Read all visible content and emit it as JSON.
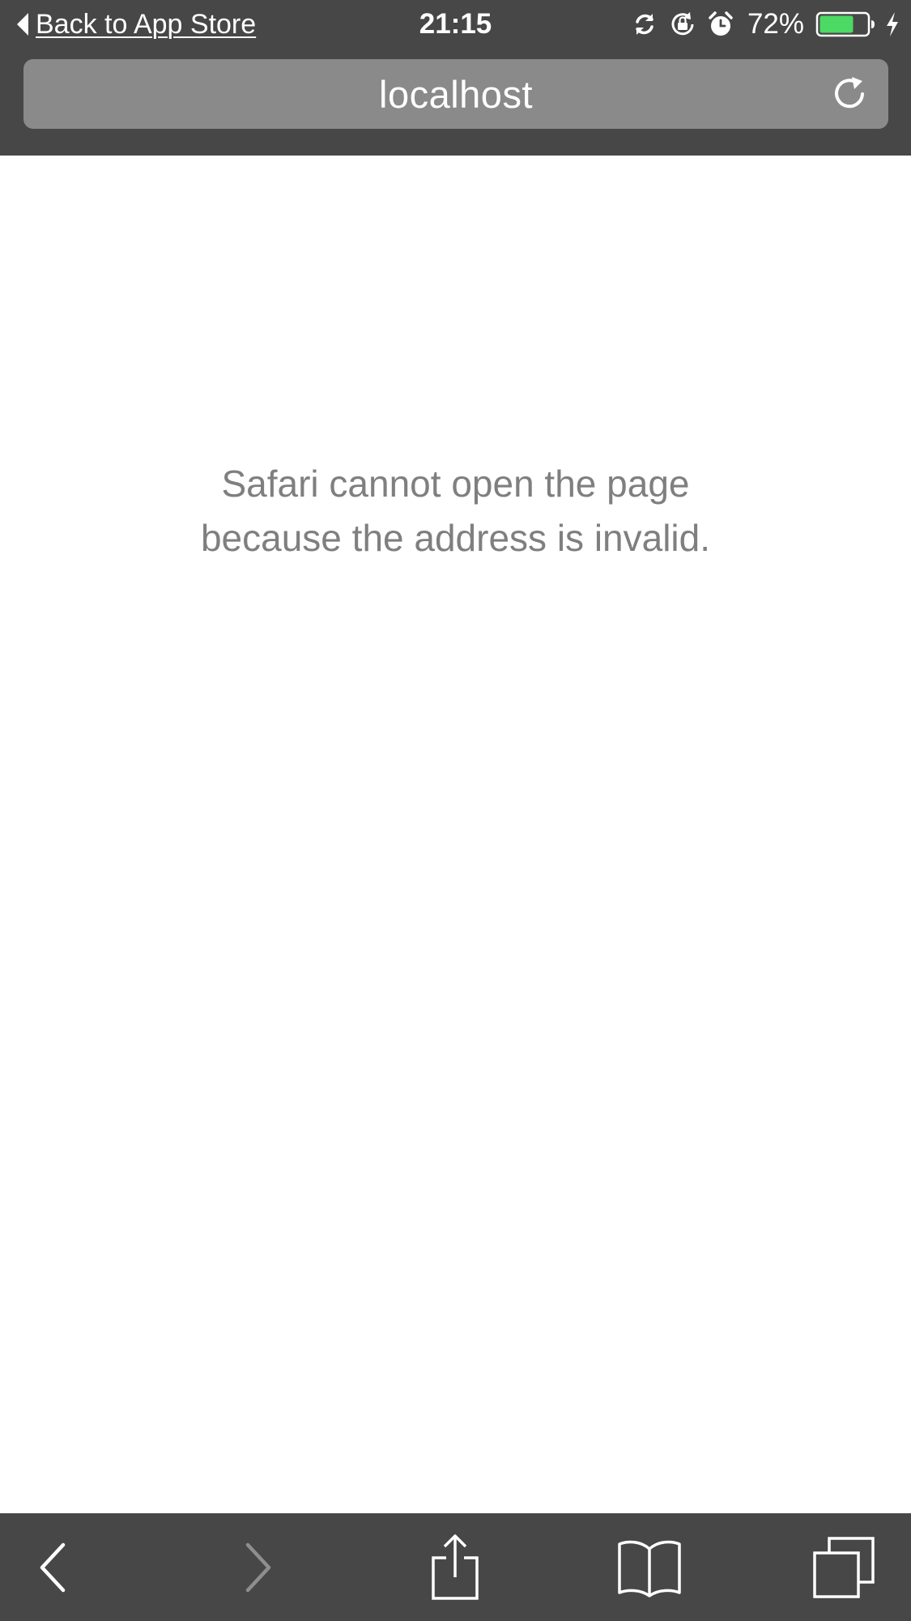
{
  "status_bar": {
    "back_label": "Back to App Store",
    "time": "21:15",
    "battery_percent": "72%",
    "battery_level": 0.72,
    "battery_color": "#4cd964",
    "icons": [
      "sync-icon",
      "rotation-lock-icon",
      "alarm-icon",
      "battery-icon",
      "charging-bolt-icon"
    ]
  },
  "url_bar": {
    "address": "localhost",
    "reload_icon": "reload-icon"
  },
  "content": {
    "error_line1": "Safari cannot open the page",
    "error_line2": "because the address is invalid."
  },
  "toolbar": {
    "items": [
      {
        "name": "back",
        "icon": "chevron-left-icon",
        "enabled": true
      },
      {
        "name": "forward",
        "icon": "chevron-right-icon",
        "enabled": false
      },
      {
        "name": "share",
        "icon": "share-icon",
        "enabled": true
      },
      {
        "name": "bookmarks",
        "icon": "book-icon",
        "enabled": true
      },
      {
        "name": "tabs",
        "icon": "tabs-icon",
        "enabled": true
      }
    ]
  },
  "colors": {
    "chrome_background": "#474747",
    "url_field": "#8a8a8a",
    "error_text": "#7f7f7f",
    "disabled_icon": "#8e8e8e"
  }
}
